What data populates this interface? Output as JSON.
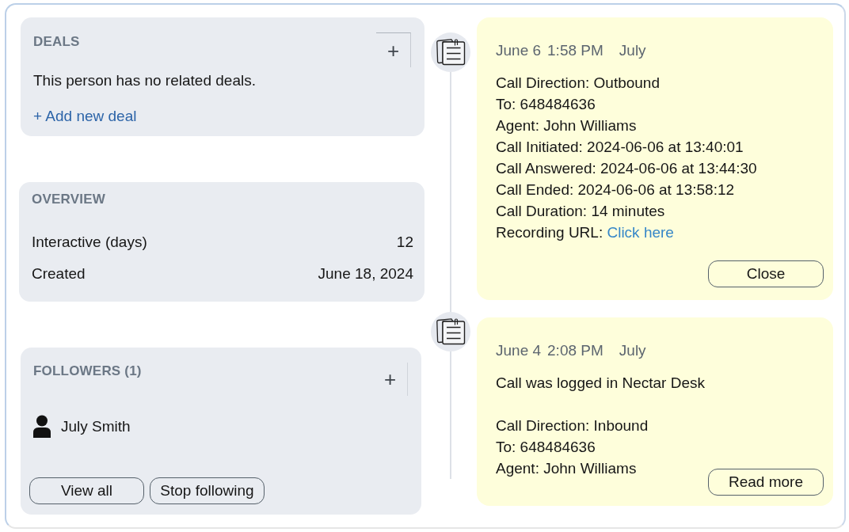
{
  "deals": {
    "title": "DEALS",
    "add_button": "+",
    "message": "This person has no related deals.",
    "add_link": "+ Add new deal"
  },
  "overview": {
    "title": "OVERVIEW",
    "rows": [
      {
        "label": "Interactive (days)",
        "value": "12"
      },
      {
        "label": "Created",
        "value": "June 18, 2024"
      }
    ]
  },
  "followers": {
    "title": "FOLLOWERS (1)",
    "add_button": "+",
    "people": [
      {
        "name": "July Smith"
      }
    ],
    "buttons": [
      "View all",
      "Stop following"
    ]
  },
  "activities": [
    {
      "date": "June 6",
      "time": "1:58 PM",
      "author": "July",
      "expanded": true,
      "lines": [
        {
          "text": "Call Direction: Outbound"
        },
        {
          "text": "To: 648484636"
        },
        {
          "text": "Agent: John Williams"
        },
        {
          "text": "Call Initiated: 2024-06-06 at 13:40:01"
        },
        {
          "text": "Call Answered: 2024-06-06 at 13:44:30"
        },
        {
          "text": "Call Ended: 2024-06-06 at 13:58:12"
        },
        {
          "text": "Call Duration: 14 minutes"
        },
        {
          "text": "Recording URL:",
          "link": "Click here"
        }
      ],
      "button": "Close"
    },
    {
      "date": "June 4",
      "time": "2:08 PM",
      "author": "July",
      "expanded": false,
      "note": "Call was logged in Nectar Desk",
      "lines": [
        {
          "text": "Call Direction: Inbound"
        },
        {
          "text": "To: 648484636"
        },
        {
          "text": "Agent: John Williams"
        }
      ],
      "button": "Read more"
    }
  ]
}
